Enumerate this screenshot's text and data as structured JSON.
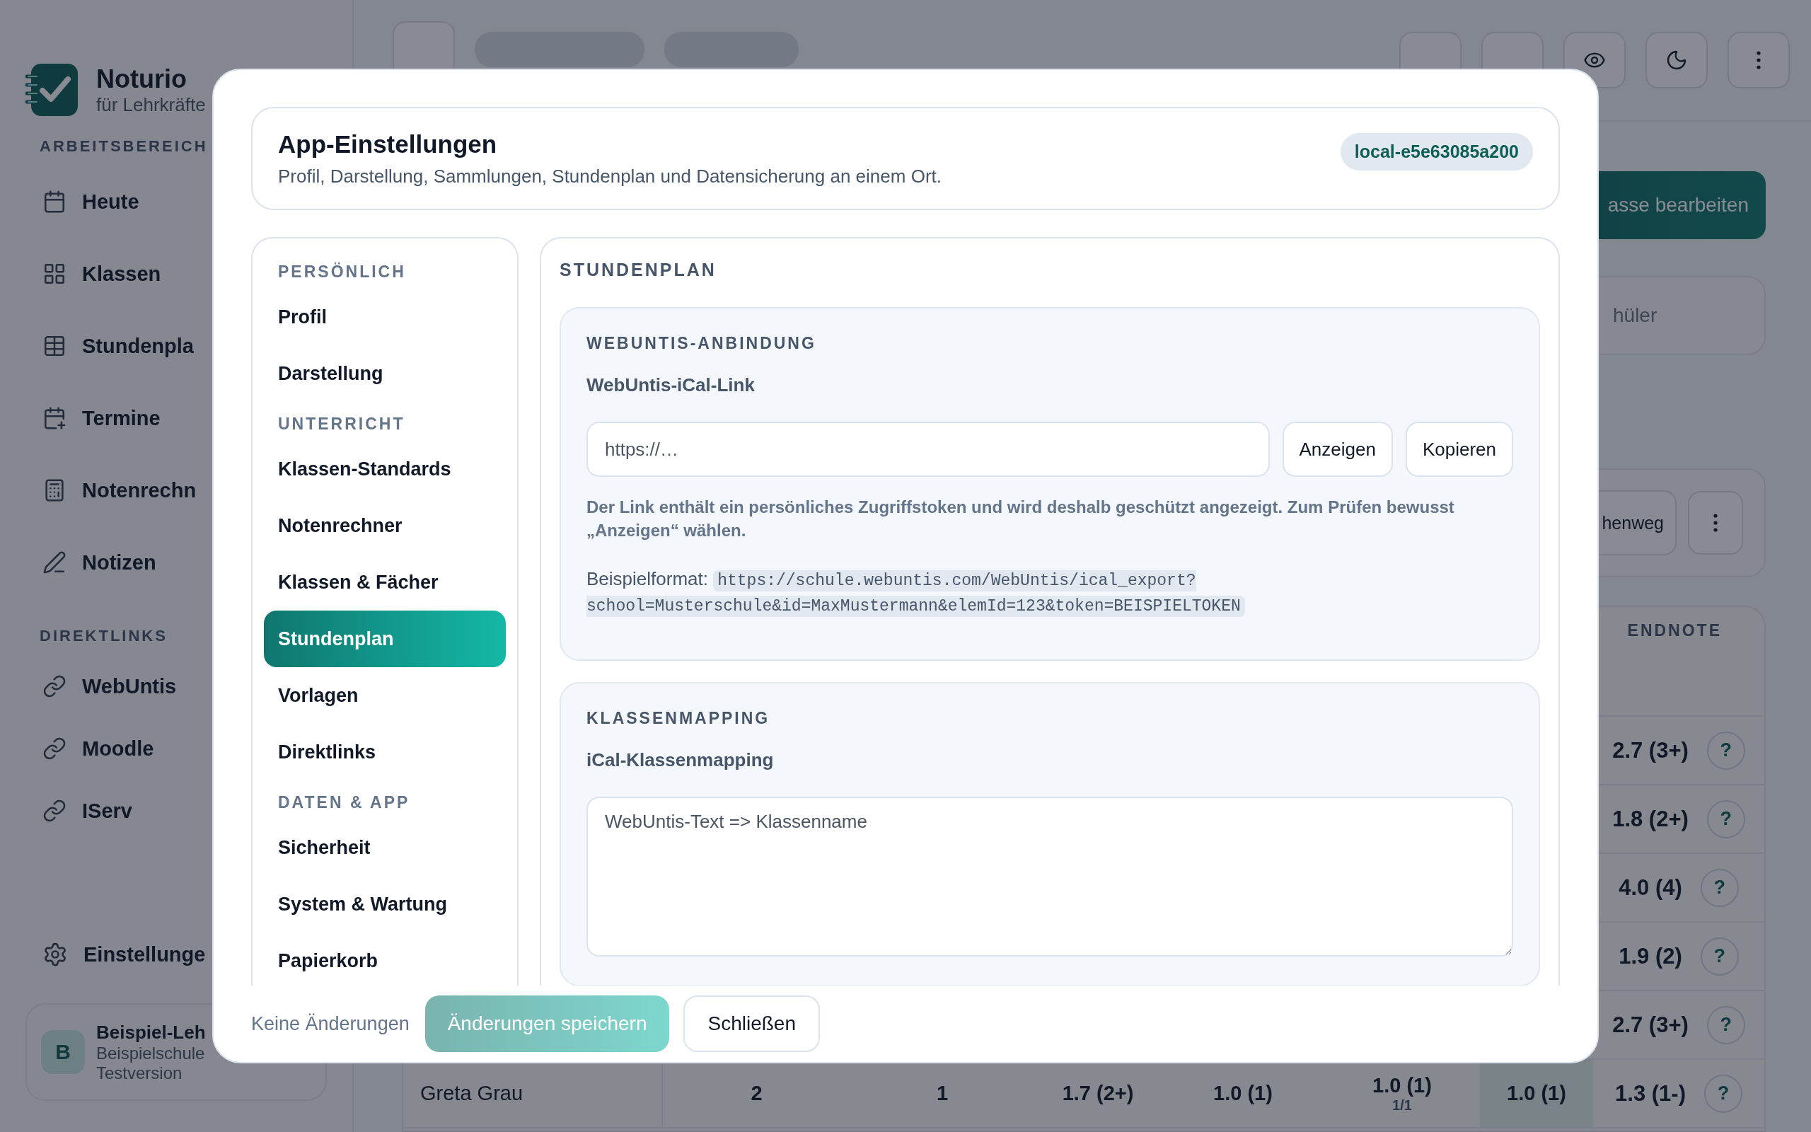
{
  "sidebar": {
    "brand": {
      "name": "Noturio",
      "tagline": "für Lehrkräfte"
    },
    "sections": [
      {
        "title": "ARBEITSBEREICH",
        "items": [
          {
            "label": "Heute"
          },
          {
            "label": "Klassen"
          },
          {
            "label": "Stundenpla"
          },
          {
            "label": "Termine"
          },
          {
            "label": "Notenrechn"
          },
          {
            "label": "Notizen"
          }
        ]
      },
      {
        "title": "DIREKTLINKS",
        "items": [
          {
            "label": "WebUntis"
          },
          {
            "label": "Moodle"
          },
          {
            "label": "IServ"
          }
        ]
      }
    ],
    "settings": "Einstellunge",
    "user": {
      "initial": "B",
      "name": "Beispiel-Leh",
      "school": "Beispielschule",
      "plan": "Testversion"
    }
  },
  "main": {
    "primary_button": "asse bearbeiten",
    "search_card": "hüler",
    "toolbar_button": "henweg",
    "table": {
      "columns": [
        "ENDNOTE"
      ],
      "rows": [
        {
          "cells": [],
          "endnote": "2.7 (3+)",
          "help": "?"
        },
        {
          "cells": [],
          "endnote": "1.8 (2+)",
          "help": "?"
        },
        {
          "cells": [],
          "endnote": "4.0 (4)",
          "help": "?"
        },
        {
          "cells": [],
          "endnote": "1.9 (2)",
          "help": "?"
        },
        {
          "cells": [],
          "endnote": "2.7 (3+)",
          "help": "?"
        },
        {
          "cells": [
            {
              "text": "Greta Grau"
            },
            {
              "text": "2"
            },
            {
              "text": "1"
            },
            {
              "text": "1.7 (2+)"
            },
            {
              "text": "1.0 (1)"
            },
            {
              "text": "1.0 (1)",
              "sub": "1/1"
            },
            {
              "text": "1.0 (1)"
            }
          ],
          "endnote": "1.3 (1-)",
          "help": "?"
        }
      ]
    }
  },
  "modal": {
    "header": {
      "title": "App-Einstellungen",
      "subtitle": "Profil, Darstellung, Sammlungen, Stundenplan und Datensicherung an einem Ort.",
      "badge": "local-e5e63085a200"
    },
    "nav": {
      "sections": [
        {
          "title": "PERSÖNLICH",
          "items": [
            {
              "label": "Profil",
              "selected": false
            },
            {
              "label": "Darstellung",
              "selected": false
            }
          ]
        },
        {
          "title": "UNTERRICHT",
          "items": [
            {
              "label": "Klassen-Standards",
              "selected": false
            },
            {
              "label": "Notenrechner",
              "selected": false
            },
            {
              "label": "Klassen & Fächer",
              "selected": false
            },
            {
              "label": "Stundenplan",
              "selected": true
            },
            {
              "label": "Vorlagen",
              "selected": false
            },
            {
              "label": "Direktlinks",
              "selected": false
            }
          ]
        },
        {
          "title": "DATEN & APP",
          "items": [
            {
              "label": "Sicherheit",
              "selected": false
            },
            {
              "label": "System & Wartung",
              "selected": false
            },
            {
              "label": "Papierkorb",
              "selected": false
            }
          ]
        }
      ]
    },
    "content": {
      "title": "STUNDENPLAN",
      "cards": [
        {
          "kind": "link",
          "title": "WEBUNTIS-ANBINDUNG",
          "label": "WebUntis-iCal-Link",
          "placeholder": "https://…",
          "buttons": [
            "Anzeigen",
            "Kopieren"
          ],
          "hint": "Der Link enthält ein persönliches Zugriffstoken und wird deshalb geschützt angezeigt. Zum Prüfen bewusst „Anzeigen“ wählen.",
          "example_label": "Beispielformat:",
          "example": "https://schule.webuntis.com/WebUntis/ical_export?school=Musterschule&id=MaxMustermann&elemId=123&token=BEISPIELTOKEN"
        },
        {
          "kind": "mapping",
          "title": "KLASSENMAPPING",
          "label": "iCal-Klassenmapping",
          "placeholder": "WebUntis-Text => Klassenname"
        }
      ]
    },
    "footer": {
      "status": "Keine Änderungen",
      "save": {
        "label": "Änderungen speichern",
        "disabled": true
      },
      "close": "Schließen"
    }
  }
}
